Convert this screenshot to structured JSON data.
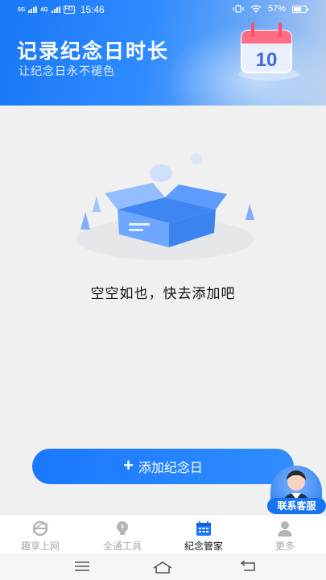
{
  "status_bar": {
    "signal1": "5G",
    "signal2": "4G",
    "hd": "HD",
    "time": "15:46",
    "battery": "57%"
  },
  "banner": {
    "title": "记录纪念日时长",
    "subtitle": "让纪念日永不褪色",
    "calendar_number": "10"
  },
  "empty_state": {
    "message": "空空如也，快去添加吧"
  },
  "add_button": {
    "label": "添加纪念日"
  },
  "customer_service": {
    "label": "联系客服"
  },
  "tabs": [
    {
      "label": "趣享上网",
      "icon": "browser-icon",
      "active": false
    },
    {
      "label": "全通工具",
      "icon": "bulb-icon",
      "active": false
    },
    {
      "label": "纪念管家",
      "icon": "calendar-icon",
      "active": true
    },
    {
      "label": "更多",
      "icon": "person-icon",
      "active": false
    }
  ],
  "colors": {
    "accent": "#1a78ff",
    "background": "#f0f0f0",
    "tab_inactive": "#a8a8a8"
  }
}
